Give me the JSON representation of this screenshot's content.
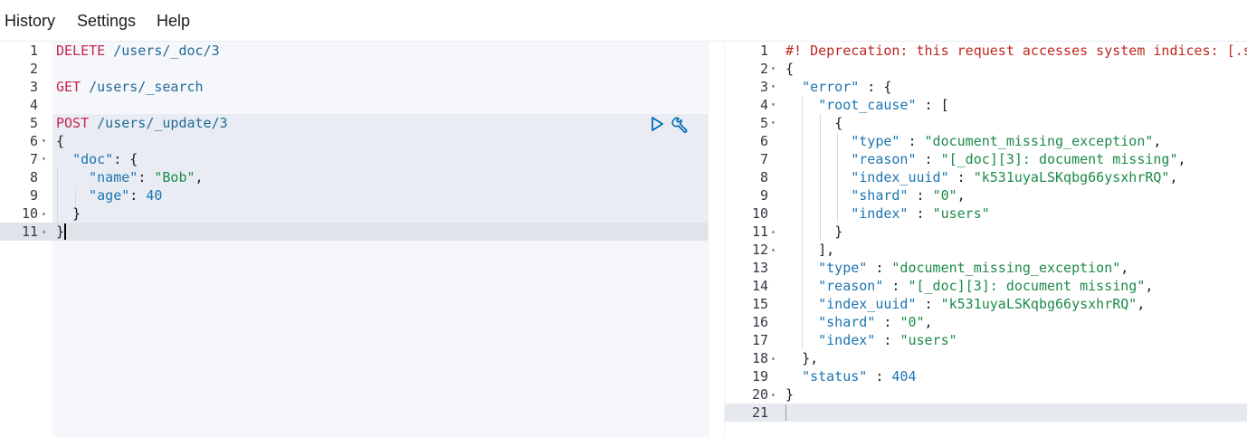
{
  "menu": {
    "history": "History",
    "settings": "Settings",
    "help": "Help"
  },
  "request": {
    "lines": [
      {
        "n": "1",
        "text": "DELETE /users/_doc/3"
      },
      {
        "n": "2",
        "text": ""
      },
      {
        "n": "3",
        "text": "GET /users/_search"
      },
      {
        "n": "4",
        "text": ""
      },
      {
        "n": "5",
        "text": "POST /users/_update/3"
      },
      {
        "n": "6",
        "text": "{"
      },
      {
        "n": "7",
        "text": "  \"doc\": {"
      },
      {
        "n": "8",
        "text": "    \"name\": \"Bob\","
      },
      {
        "n": "9",
        "text": "    \"age\": 40"
      },
      {
        "n": "10",
        "text": "  }"
      },
      {
        "n": "11",
        "text": "}"
      }
    ]
  },
  "response": {
    "lines": [
      {
        "n": "1",
        "text": "#! Deprecation: this request accesses system indices: [.secu"
      },
      {
        "n": "2",
        "text": "{"
      },
      {
        "n": "3",
        "text": "  \"error\" : {"
      },
      {
        "n": "4",
        "text": "    \"root_cause\" : ["
      },
      {
        "n": "5",
        "text": "      {"
      },
      {
        "n": "6",
        "text": "        \"type\" : \"document_missing_exception\","
      },
      {
        "n": "7",
        "text": "        \"reason\" : \"[_doc][3]: document missing\","
      },
      {
        "n": "8",
        "text": "        \"index_uuid\" : \"k531uyaLSKqbg66ysxhrRQ\","
      },
      {
        "n": "9",
        "text": "        \"shard\" : \"0\","
      },
      {
        "n": "10",
        "text": "        \"index\" : \"users\""
      },
      {
        "n": "11",
        "text": "      }"
      },
      {
        "n": "12",
        "text": "    ],"
      },
      {
        "n": "13",
        "text": "    \"type\" : \"document_missing_exception\","
      },
      {
        "n": "14",
        "text": "    \"reason\" : \"[_doc][3]: document missing\","
      },
      {
        "n": "15",
        "text": "    \"index_uuid\" : \"k531uyaLSKqbg66ysxhrRQ\","
      },
      {
        "n": "16",
        "text": "    \"shard\" : \"0\","
      },
      {
        "n": "17",
        "text": "    \"index\" : \"users\""
      },
      {
        "n": "18",
        "text": "  },"
      },
      {
        "n": "19",
        "text": "  \"status\" : 404"
      },
      {
        "n": "20",
        "text": "}"
      },
      {
        "n": "21",
        "text": ""
      }
    ]
  },
  "icons": {
    "run": "play-icon",
    "wrench": "wrench-icon"
  }
}
